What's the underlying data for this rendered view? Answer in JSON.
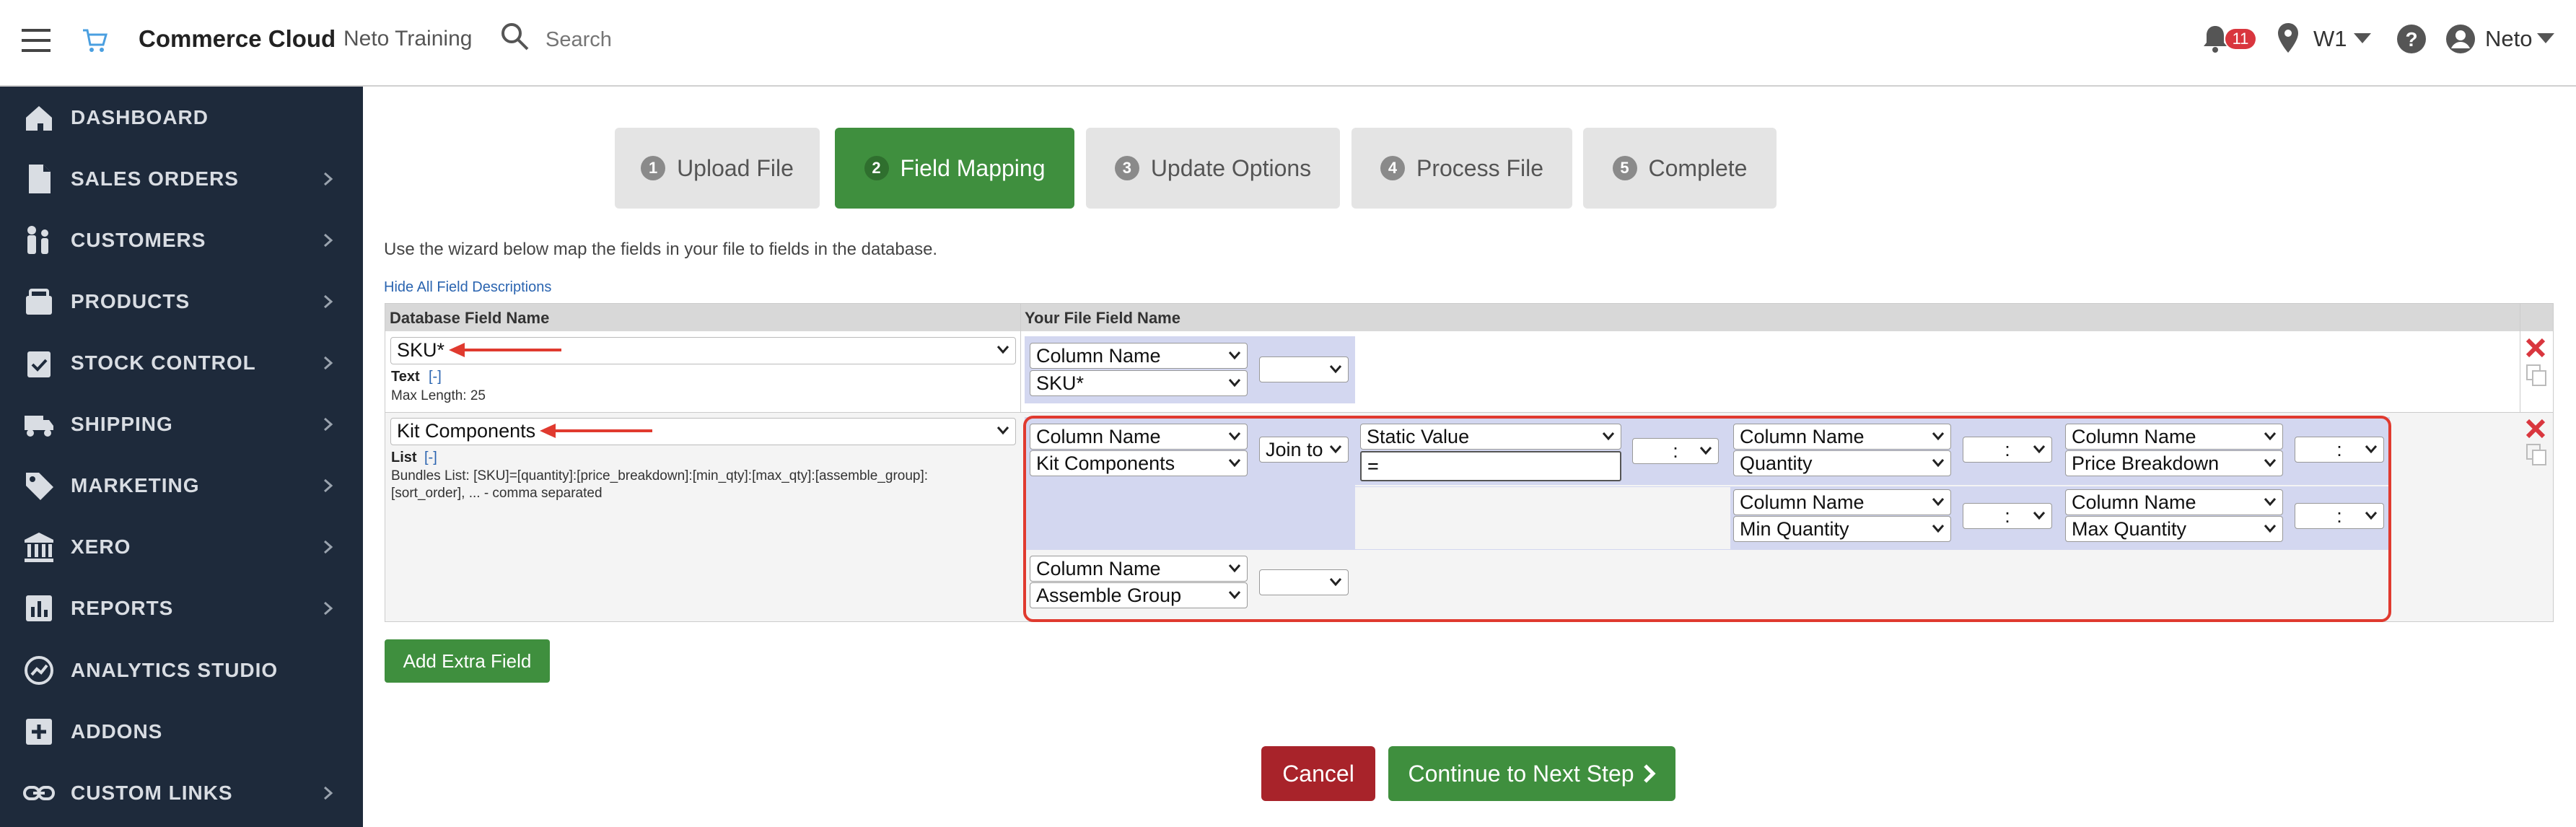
{
  "header": {
    "brand": "Commerce Cloud",
    "store": "Neto Training",
    "search_placeholder": "Search",
    "notif_count": "11",
    "location": "W1",
    "user": "Neto"
  },
  "sidebar": {
    "items": [
      {
        "label": "DASHBOARD",
        "icon": "home-icon"
      },
      {
        "label": "SALES ORDERS",
        "icon": "document-icon"
      },
      {
        "label": "CUSTOMERS",
        "icon": "people-icon"
      },
      {
        "label": "PRODUCTS",
        "icon": "box-icon"
      },
      {
        "label": "STOCK CONTROL",
        "icon": "clipboard-check-icon"
      },
      {
        "label": "SHIPPING",
        "icon": "truck-icon"
      },
      {
        "label": "MARKETING",
        "icon": "tag-icon"
      },
      {
        "label": "XERO",
        "icon": "bank-icon"
      },
      {
        "label": "REPORTS",
        "icon": "bar-chart-icon"
      },
      {
        "label": "ANALYTICS STUDIO",
        "icon": "analytics-icon"
      },
      {
        "label": "ADDONS",
        "icon": "plus-square-icon"
      },
      {
        "label": "CUSTOM LINKS",
        "icon": "link-icon"
      }
    ]
  },
  "wizard": {
    "steps": [
      {
        "num": "1",
        "label": "Upload File"
      },
      {
        "num": "2",
        "label": "Field Mapping"
      },
      {
        "num": "3",
        "label": "Update Options"
      },
      {
        "num": "4",
        "label": "Process File"
      },
      {
        "num": "5",
        "label": "Complete"
      }
    ],
    "active_step": 2
  },
  "intro_text": "Use the wizard below map the fields in your file to fields in the database.",
  "hide_link": "Hide All Field Descriptions",
  "table": {
    "headers": [
      "Database Field Name",
      "Your File Field Name"
    ],
    "rows": [
      {
        "db_field": "SKU*",
        "type": "Text",
        "toggle": "[-]",
        "desc": "Max Length: 25",
        "mapping": {
          "col_label": "Column Name",
          "col_value": "SKU*"
        }
      },
      {
        "db_field": "Kit Components",
        "type": "List",
        "toggle": "[-]",
        "desc_line1": "Bundles List: [SKU]=[quantity]:[price_breakdown]:[min_qty]:[max_qty]:[assemble_group]:",
        "desc_line2": "[sort_order], ... - comma separated",
        "join": "Join to",
        "static_label": "Static Value",
        "static_value": "=",
        "sep": ":",
        "groups": [
          {
            "label": "Column Name",
            "value": "Kit Components"
          },
          {
            "label": "Column Name",
            "value": "Quantity"
          },
          {
            "label": "Column Name",
            "value": "Price Breakdown"
          },
          {
            "label": "Column Name",
            "value": "Min Quantity"
          },
          {
            "label": "Column Name",
            "value": "Max Quantity"
          },
          {
            "label": "Column Name",
            "value": "Assemble Group"
          }
        ]
      }
    ]
  },
  "buttons": {
    "add_extra": "Add Extra Field",
    "cancel": "Cancel",
    "next": "Continue to Next Step"
  },
  "colors": {
    "sidebar": "#1e2a3b",
    "accent_green": "#3f8f3e",
    "cancel_red": "#a8232a",
    "highlight_red": "#e03a2f",
    "mapping_bg": "#d3d7f0"
  }
}
